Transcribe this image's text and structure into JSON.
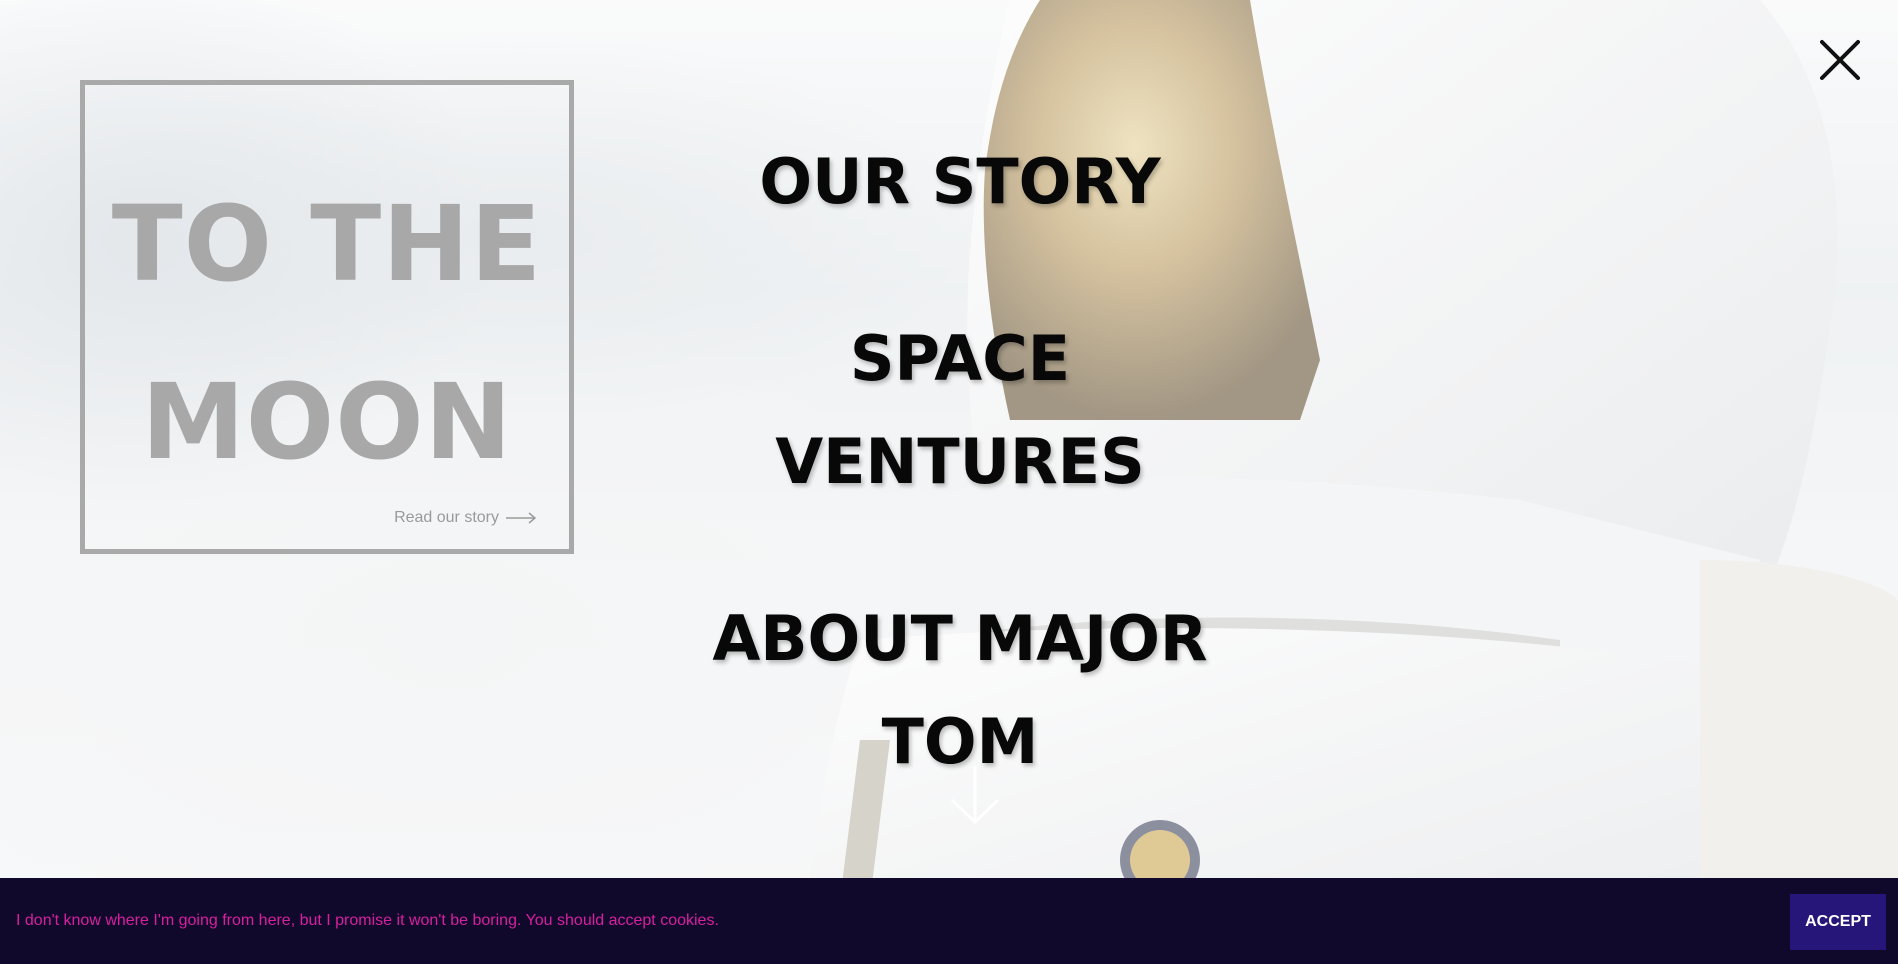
{
  "promo": {
    "title_line1": "TO THE",
    "title_line2": "MOON",
    "link_label": "Read our story"
  },
  "nav": {
    "items": [
      {
        "line1": "OUR STORY",
        "line2": ""
      },
      {
        "line1": "SPACE",
        "line2": "VENTURES"
      },
      {
        "line1": "ABOUT MAJOR",
        "line2": "TOM"
      }
    ]
  },
  "cookie": {
    "message": "I don't know where I'm going from here, but I promise it won't be boring. You should accept cookies.",
    "accept_label": "ACCEPT"
  },
  "colors": {
    "cookie_bg": "#10092c",
    "cookie_text": "#d81f9f",
    "accept_bg": "#26167a",
    "nav_text": "#080808",
    "promo_gray": "#a8a8a8"
  },
  "icons": {
    "close": "close-icon",
    "link_arrow": "arrow-right-icon",
    "scroll": "arrow-down-icon"
  }
}
